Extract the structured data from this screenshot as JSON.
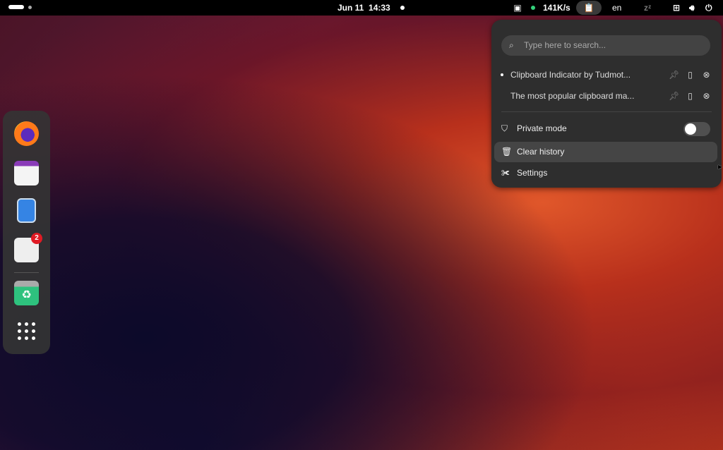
{
  "topbar": {
    "date": "Jun 11",
    "time": "14:33",
    "net_speed": "141K/s",
    "lang": "en"
  },
  "clipboard_menu": {
    "search_placeholder": "Type here to search...",
    "items": [
      {
        "text": "Clipboard Indicator by Tudmot...",
        "active": true
      },
      {
        "text": "The most popular clipboard ma...",
        "active": false
      }
    ],
    "private_mode_label": "Private mode",
    "private_mode_on": false,
    "clear_history_label": "Clear history",
    "settings_label": "Settings"
  },
  "dock": {
    "apps": [
      {
        "name": "Firefox"
      },
      {
        "name": "Calendar"
      },
      {
        "name": "Files"
      },
      {
        "name": "Software",
        "badge": "2"
      },
      {
        "name": "Trash"
      }
    ],
    "show_apps": "Show Apps"
  }
}
